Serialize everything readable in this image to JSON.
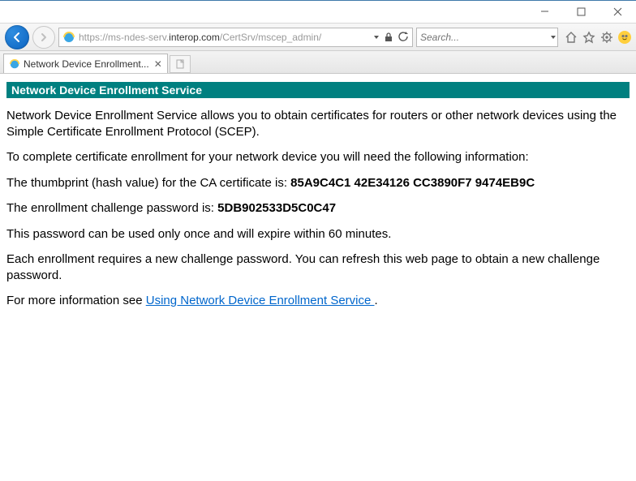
{
  "window": {
    "url_prefix_gray": "https://",
    "url_host": "ms-ndes-serv.",
    "url_domain": "interop.com",
    "url_path_gray": "/CertSrv/mscep_admin/",
    "tab_title": "Network Device Enrollment...",
    "search_placeholder": "Search..."
  },
  "content": {
    "banner": "Network Device Enrollment Service",
    "intro": "Network Device Enrollment Service allows you to obtain certificates for routers or other network devices using the Simple Certificate Enrollment Protocol (SCEP).",
    "need_info": "To complete certificate enrollment for your network device you will need the following information:",
    "thumb_label": "The thumbprint (hash value) for the CA certificate is: ",
    "thumb_value": "85A9C4C1 42E34126 CC3890F7 9474EB9C",
    "pwd_label": "The enrollment challenge password is: ",
    "pwd_value": "5DB902533D5C0C47",
    "expire": "This password can be used only once and will expire within 60 minutes.",
    "refresh": "Each enrollment requires a new challenge password. You can refresh this web page to obtain a new challenge password.",
    "more_prefix": "For more information see ",
    "more_link": "Using Network Device Enrollment Service ",
    "more_suffix": "."
  }
}
